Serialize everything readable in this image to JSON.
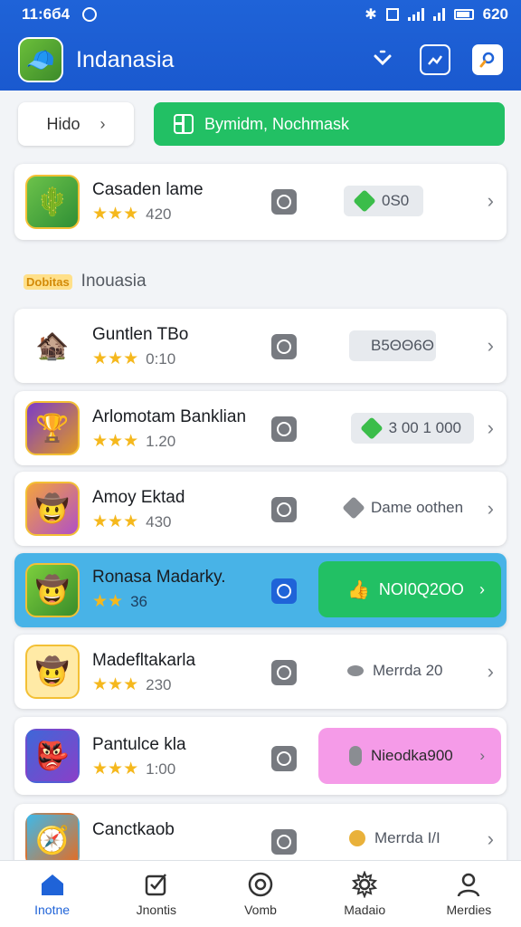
{
  "status_bar": {
    "time": "11:6б4",
    "battery_text": "620"
  },
  "app_bar": {
    "title": "Indanasia"
  },
  "filters": {
    "chip_label": "Hido",
    "primary_button_label": "Bymidm, Nochmask"
  },
  "featured": {
    "name": "Casaden lame",
    "rating": "420",
    "price": "0S0",
    "price_icon": "green-gem",
    "accent": "#3bbd4a"
  },
  "section": {
    "logo_text": "Dobitas",
    "title": "Inouasia"
  },
  "games": [
    {
      "name": "Guntlen TBo",
      "rating": "0:10",
      "price": "B5ΘΘ6Θ",
      "price_icon": "purple-gem"
    },
    {
      "name": "Arlomotam Banklian",
      "rating": "1.20",
      "price": "3 00 1 000",
      "price_icon": "green-gem"
    },
    {
      "name": "Amoy Ektad",
      "rating": "430",
      "price": "Dame oothen",
      "price_icon": "gray-gem"
    },
    {
      "name": "Ronasa Madarky.",
      "rating": "36",
      "price": "NOI0Q2OO",
      "price_icon": "thumbs-up",
      "selected": true
    },
    {
      "name": "Madefltakarla",
      "rating": "230",
      "price": "Merrda 20",
      "price_icon": "gray-coin"
    },
    {
      "name": "Pantulce kla",
      "rating": "1:00",
      "price": "Nieodka900",
      "price_icon": "gray-capsule"
    },
    {
      "name": "Canctkaob",
      "rating": "",
      "price": "Merrda I/I",
      "price_icon": "gold-coin"
    }
  ],
  "bottom_nav": [
    {
      "label": "Inotne",
      "icon": "home-icon",
      "active": true
    },
    {
      "label": "Jnontis",
      "icon": "checkbox-icon"
    },
    {
      "label": "Vomb",
      "icon": "circle-icon"
    },
    {
      "label": "Madaio",
      "icon": "gear-icon"
    },
    {
      "label": "Merdies",
      "icon": "person-icon"
    }
  ],
  "colors": {
    "primary_blue": "#1f63d8",
    "green": "#22c064",
    "selected_row": "#48b3e7",
    "pink": "#f59be8"
  }
}
